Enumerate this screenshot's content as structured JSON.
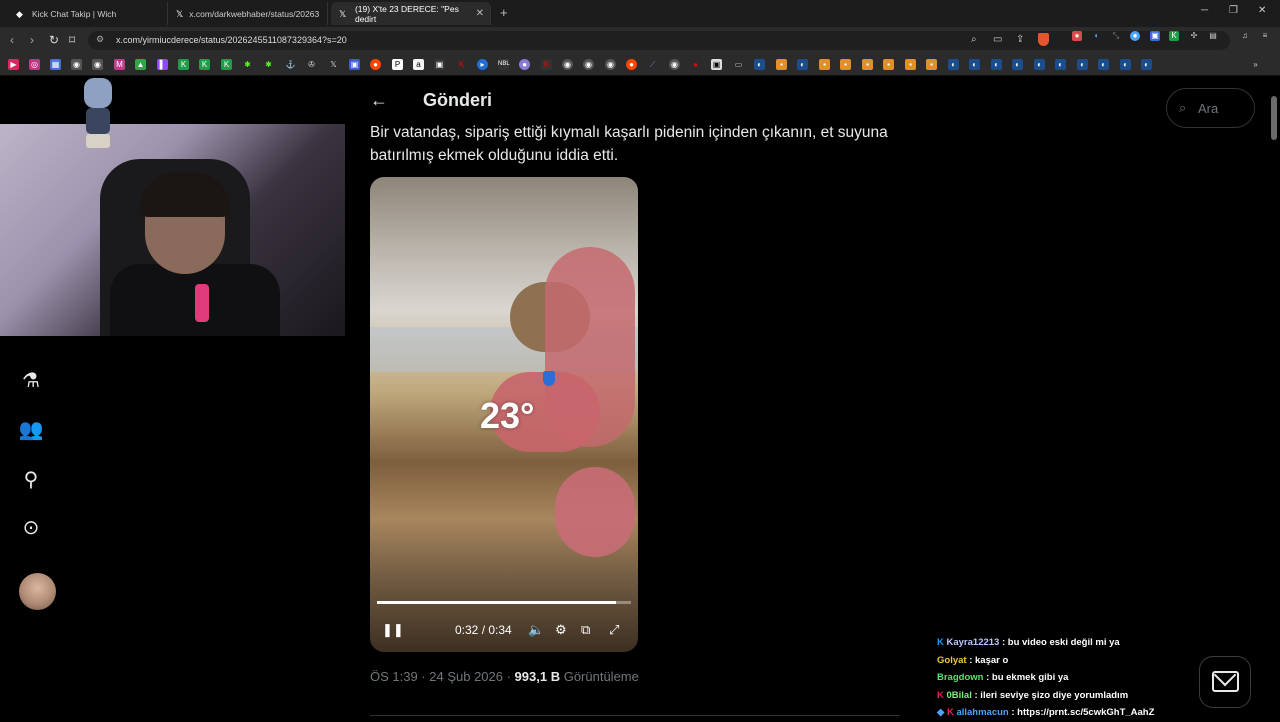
{
  "browser": {
    "tabs": [
      {
        "label": "Kick Chat Takip | Wich",
        "icon": "kick-chat-favicon"
      },
      {
        "label": "x.com/darkwebhaber/status/20263",
        "icon": "x-logo-icon"
      },
      {
        "label": "(19) X'te 23 DERECE: \"Pes dedirt",
        "icon": "x-logo-icon"
      }
    ],
    "url": "x.com/yirmiucderece/status/2026245511087329364?s=20"
  },
  "post": {
    "header_title": "Gönderi",
    "text": "Bir vatandaş, sipariş ettiği kıymalı kaşarlı pidenin içinden çıkanın,  et suyuna batırılmış ekmek olduğunu iddia etti.",
    "video": {
      "watermark": "23°",
      "time": "0:32 / 0:34",
      "progress": 0.94
    },
    "meta_time": "ÖS 1:39 · 24 Şub 2026 · ",
    "views_count": "993,1 B",
    "views_label": " Görüntüleme"
  },
  "search": {
    "placeholder": "Ara"
  },
  "chat": [
    {
      "user": "Kayra12213",
      "text": " : bu video eski değil mi ya",
      "color": "#b7c6ff"
    },
    {
      "user": "Golyat",
      "text": " : kaşar o",
      "color": "#f5c542"
    },
    {
      "user": "Bragdown",
      "text": " : bu ekmek gibi ya",
      "color": "#5be36b"
    },
    {
      "user": "0Bilal",
      "text": " : ileri seviye şizo diye yorumladım",
      "color": "#7cf27c"
    },
    {
      "user": "allahmacun",
      "text": " : https://prnt.sc/5cwkGhT_AahZ",
      "color": "#4aa3ff"
    }
  ],
  "colors": {
    "accent": "#1d9bf0",
    "background": "#000000",
    "text": "#e7e9ea",
    "muted": "#71767b"
  }
}
